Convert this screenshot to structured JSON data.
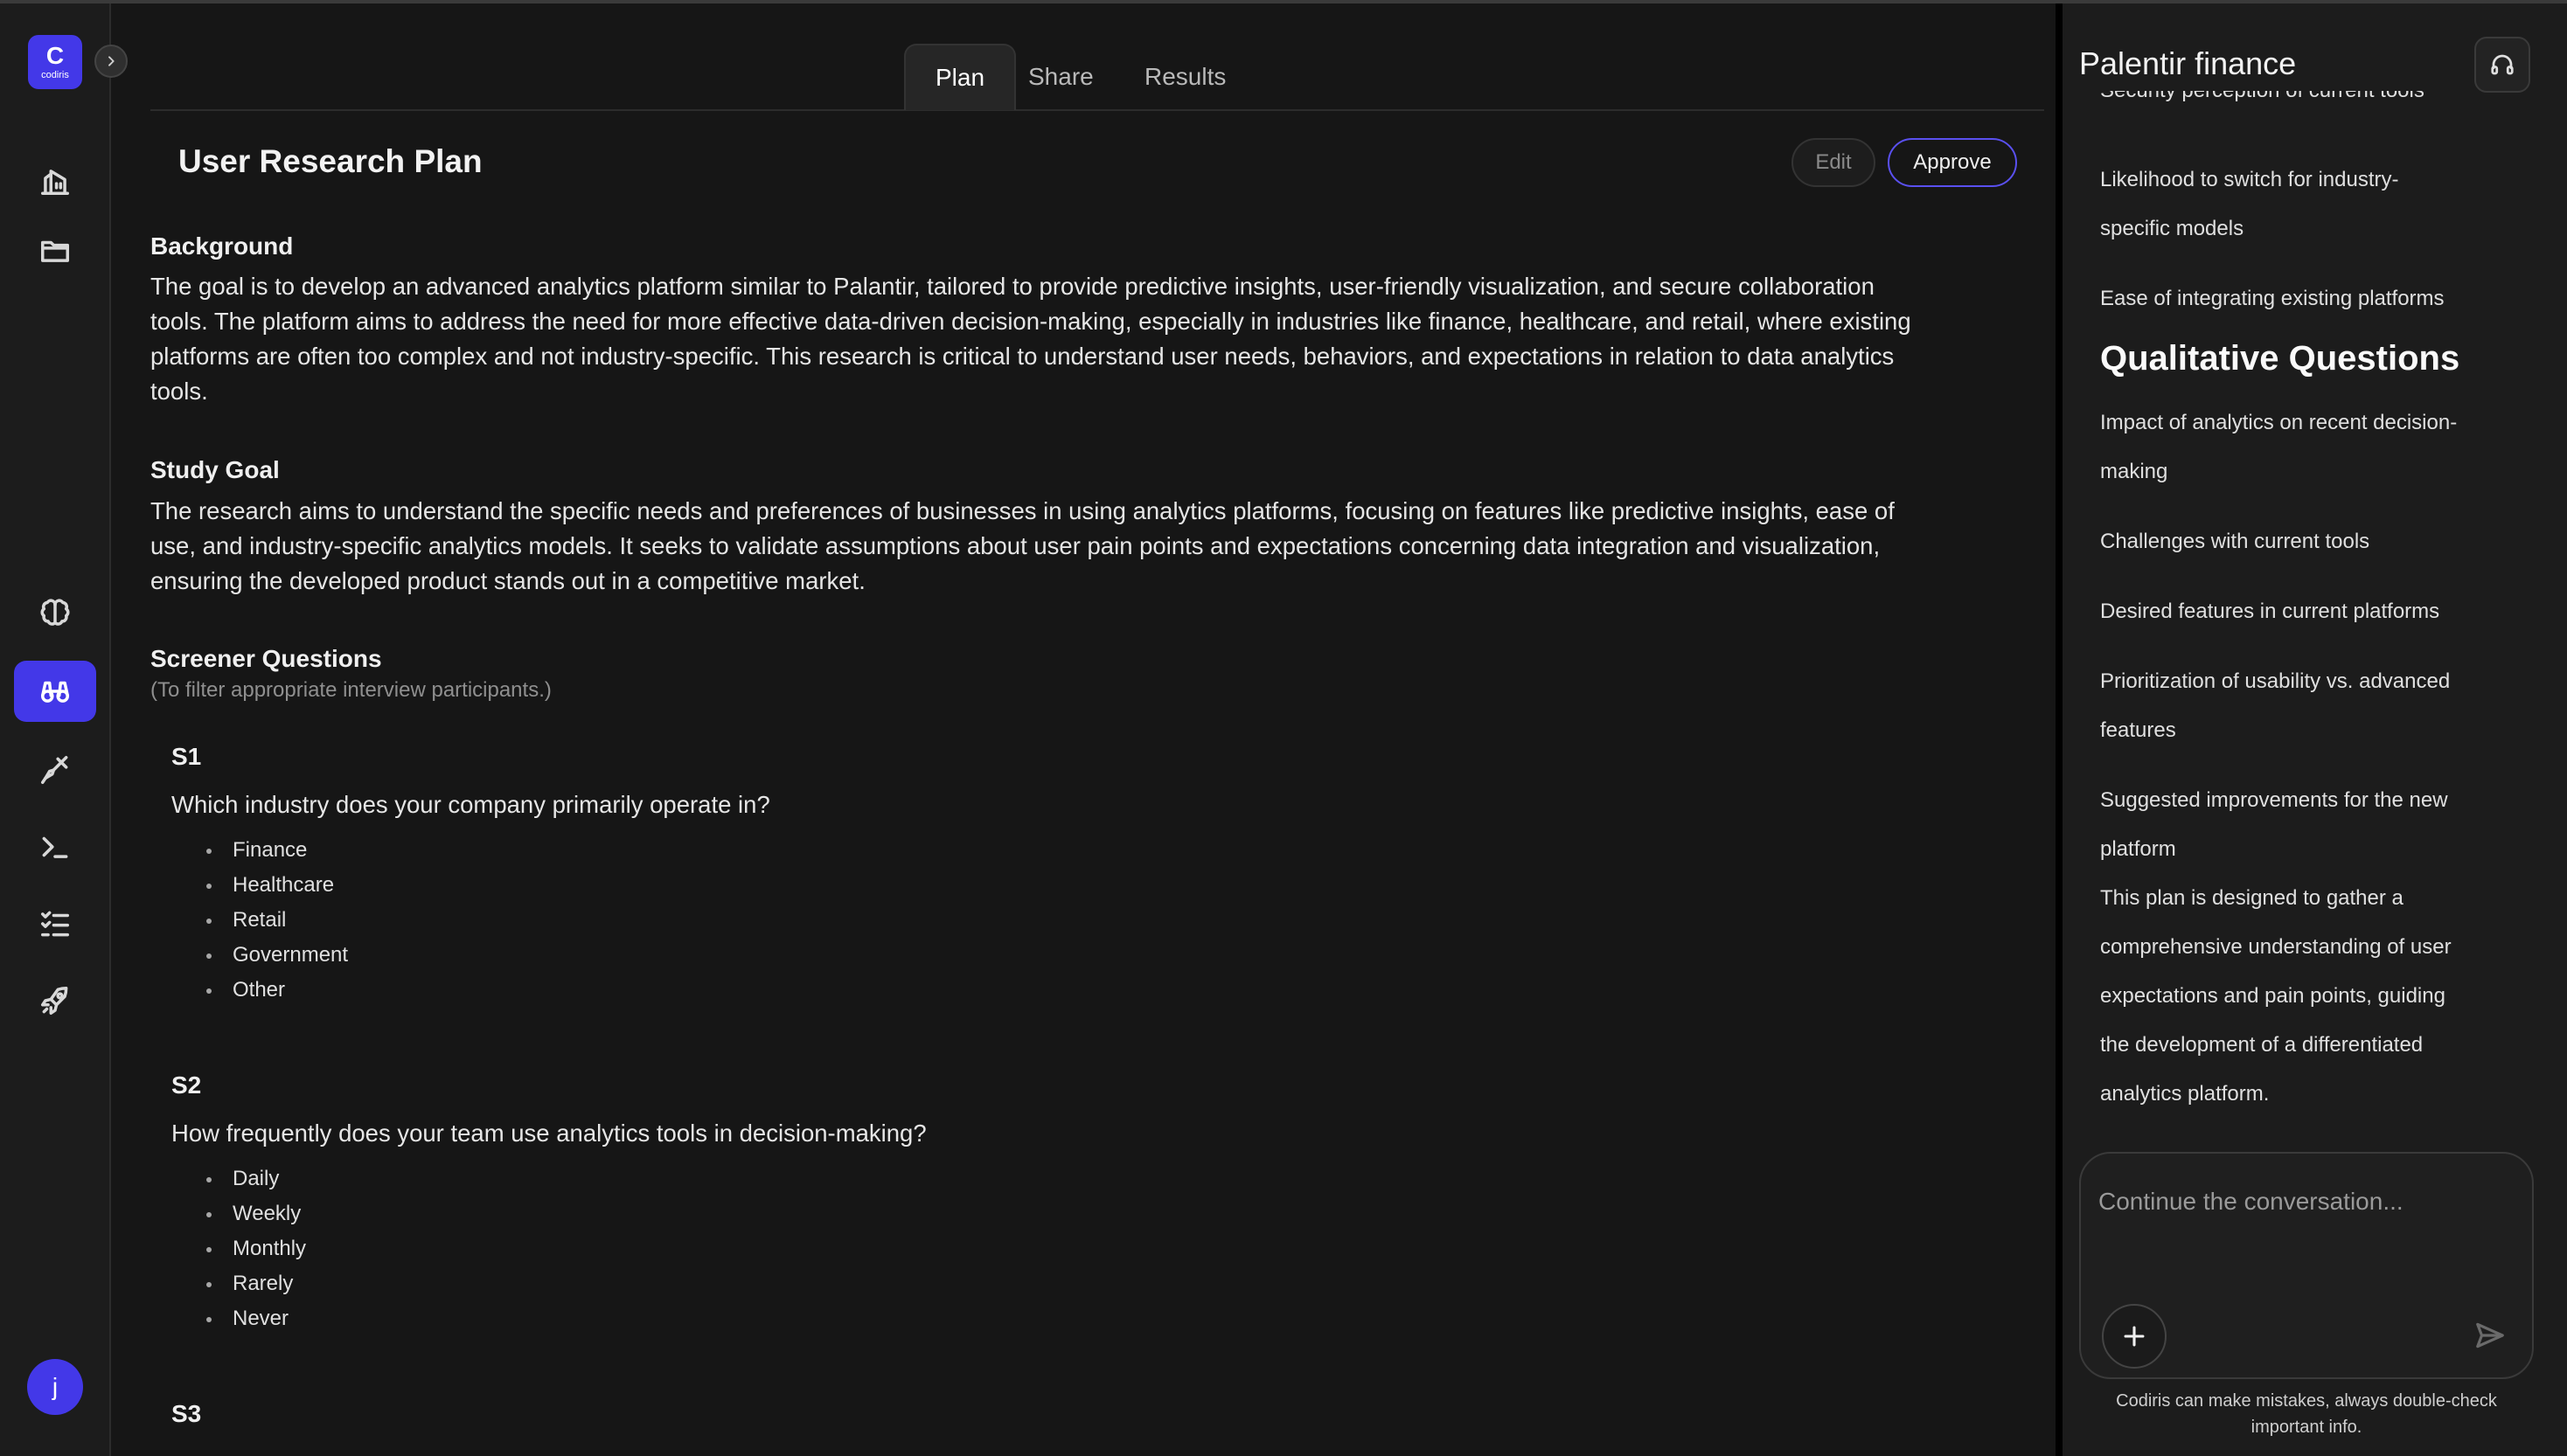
{
  "brand": {
    "logo_glyph": "C",
    "logo_word": "codiris",
    "accent": "#4338e8"
  },
  "rail": {
    "items": [
      {
        "name": "home",
        "icon": "home-icon",
        "active": false
      },
      {
        "name": "projects",
        "icon": "folder-icon",
        "active": false
      },
      {
        "name": "brain",
        "icon": "brain-icon",
        "active": false
      },
      {
        "name": "research",
        "icon": "binoculars-icon",
        "active": true
      },
      {
        "name": "design",
        "icon": "brush-icon",
        "active": false
      },
      {
        "name": "terminal",
        "icon": "terminal-icon",
        "active": false
      },
      {
        "name": "tasks",
        "icon": "checklist-icon",
        "active": false
      },
      {
        "name": "launch",
        "icon": "rocket-icon",
        "active": false
      }
    ],
    "user_initial": "j"
  },
  "tabs": [
    {
      "label": "Plan",
      "active": true
    },
    {
      "label": "Share",
      "active": false
    },
    {
      "label": "Results",
      "active": false
    }
  ],
  "plan": {
    "title": "User Research Plan",
    "edit_label": "Edit",
    "approve_label": "Approve",
    "background": {
      "heading": "Background",
      "lines": [
        "The goal is to develop an advanced analytics platform similar to Palantir, tailored to provide predictive insights, user-friendly visualization, and secure collaboration",
        "tools. The platform aims to address the need for more effective data-driven decision-making, especially in industries like finance, healthcare, and retail, where existing",
        "platforms are often too complex and not industry-specific. This research is critical to understand user needs, behaviors, and expectations in relation to data analytics",
        "tools."
      ]
    },
    "study_goal": {
      "heading": "Study Goal",
      "lines": [
        "The research aims to understand the specific needs and preferences of businesses in using analytics platforms, focusing on features like predictive insights, ease of",
        "use, and industry-specific analytics models. It seeks to validate assumptions about user pain points and expectations concerning data integration and visualization,",
        "ensuring the developed product stands out in a competitive market."
      ]
    },
    "screener": {
      "heading": "Screener Questions",
      "hint": "(To filter appropriate interview participants.)",
      "questions": [
        {
          "id": "S1",
          "text": "Which industry does your company primarily operate in?",
          "options": [
            "Finance",
            "Healthcare",
            "Retail",
            "Government",
            "Other"
          ]
        },
        {
          "id": "S2",
          "text": "How frequently does your team use analytics tools in decision-making?",
          "options": [
            "Daily",
            "Weekly",
            "Monthly",
            "Rarely",
            "Never"
          ]
        },
        {
          "id": "S3"
        }
      ]
    }
  },
  "chat": {
    "title": "Palentir finance",
    "clipped_line": "Security perception of current tools",
    "lines_a": [
      "Likelihood to switch for industry-",
      "specific models",
      "",
      "Ease of integrating existing platforms"
    ],
    "qual_heading": "Qualitative Questions",
    "lines_b": [
      "Impact of analytics on recent decision-",
      "making",
      "",
      "Challenges with current tools",
      "",
      "Desired features in current platforms",
      "",
      "Prioritization of usability vs. advanced",
      "features",
      "",
      "Suggested improvements for the new",
      "platform"
    ],
    "summary_lines": [
      "This plan is designed to gather a",
      "comprehensive understanding of user",
      "expectations and pain points, guiding",
      "the development of a differentiated",
      "analytics platform."
    ],
    "composer_placeholder": "Continue the conversation...",
    "disclaimer_lines": [
      "Codiris can make mistakes, always double-check",
      "important info."
    ]
  }
}
